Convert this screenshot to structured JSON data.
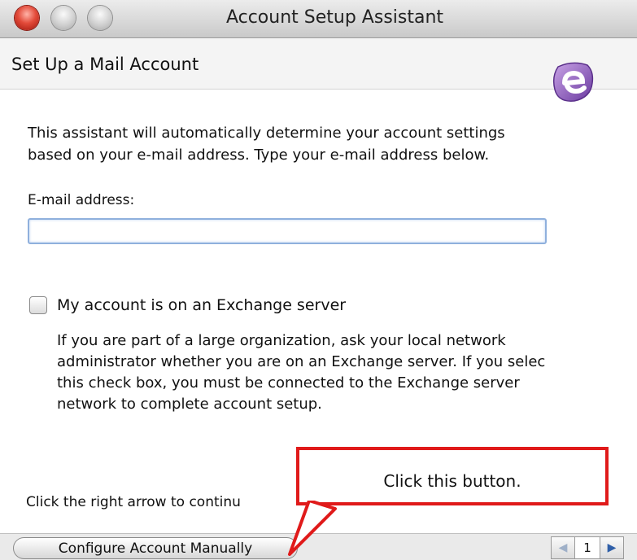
{
  "window": {
    "title": "Account Setup Assistant"
  },
  "header": {
    "title": "Set Up a Mail Account",
    "logo_icon": "entourage-logo-icon"
  },
  "intro": {
    "line1": "This assistant will automatically determine your account settings",
    "line2": "based on your e-mail address. Type your e-mail address below."
  },
  "email_field": {
    "label": "E-mail address:",
    "value": ""
  },
  "exchange": {
    "checkbox_label": "My account is on an Exchange server",
    "checked": false,
    "desc_line1": "If you are part of a large organization, ask your local network",
    "desc_line2": "administrator whether you are on an Exchange server. If you selec",
    "desc_line3": "this check box, you must be connected to the Exchange server",
    "desc_line4": "network to complete account setup."
  },
  "footer": {
    "continue_text": "Click the right arrow to continu",
    "configure_button": "Configure Account Manually",
    "page_number": "1"
  },
  "callout": {
    "text": "Click this button.",
    "color": "#e01a1a"
  }
}
